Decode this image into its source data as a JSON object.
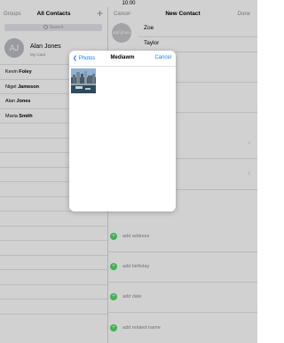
{
  "status": {
    "time": "10:00"
  },
  "contacts_pane": {
    "nav": {
      "groups": "Groups",
      "title": "All Contacts",
      "add": "+"
    },
    "search": {
      "placeholder": "Search"
    },
    "my_card": {
      "initials": "AJ",
      "name": "Alan Jones",
      "subtitle": "My Card"
    },
    "contacts": [
      {
        "first": "Kevin",
        "last": "Foley"
      },
      {
        "first": "Nigel",
        "last": "Jameson"
      },
      {
        "first": "Alan",
        "last": "Jones"
      },
      {
        "first": "Maria",
        "last": "Smith"
      }
    ]
  },
  "new_contact": {
    "nav": {
      "cancel": "Cancel",
      "title": "New Contact",
      "done": "Done"
    },
    "add_photo": "add photo",
    "first_name": "Zoe",
    "last_name": "Taylor",
    "fields": [
      "add address",
      "add birthday",
      "add date",
      "add related name"
    ]
  },
  "photo_picker": {
    "back": "Photos",
    "title": "Mediawm",
    "cancel": "Cancel"
  },
  "colors": {
    "accent": "#1a7cf5",
    "add_green": "#4cd964",
    "avatar_gray": "#bcbec4"
  }
}
